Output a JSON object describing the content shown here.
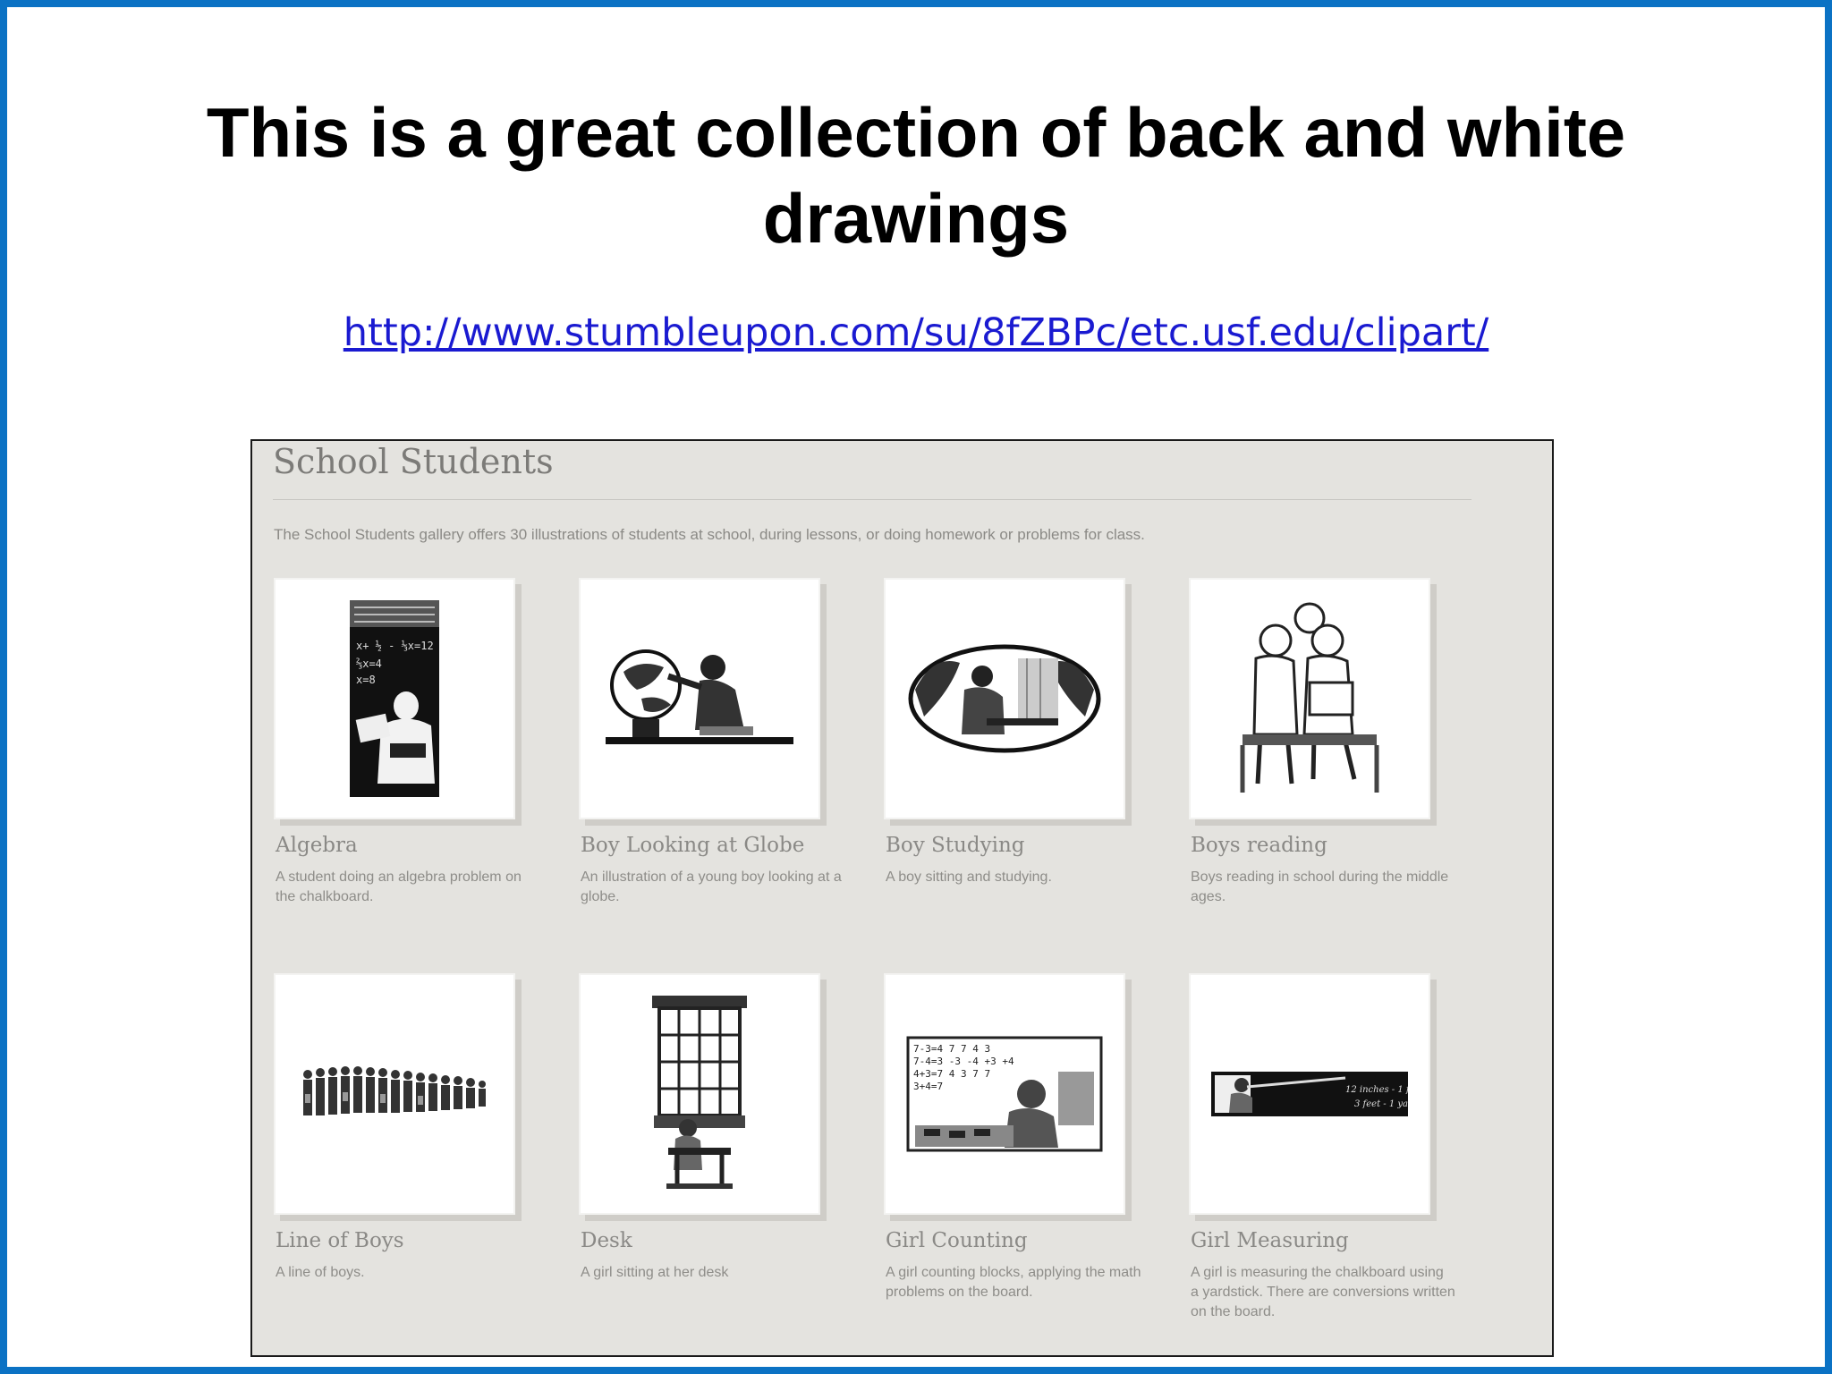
{
  "slide": {
    "title": "This is a great collection of back and white drawings",
    "link": "http://www.stumbleupon.com/su/8fZBPc/etc.usf.edu/clipart/"
  },
  "gallery": {
    "heading": "School Students",
    "intro": "The School Students gallery offers 30 illustrations of students at school, during lessons, or doing homework or problems for class.",
    "items": [
      {
        "title": "Algebra",
        "description": "A student doing an algebra problem on the chalkboard."
      },
      {
        "title": "Boy Looking at Globe",
        "description": "An illustration of a young boy looking at a globe."
      },
      {
        "title": "Boy Studying",
        "description": "A boy sitting and studying."
      },
      {
        "title": "Boys reading",
        "description": "Boys reading in school during the middle ages."
      },
      {
        "title": "Line of Boys",
        "description": "A line of boys."
      },
      {
        "title": "Desk",
        "description": "A girl sitting at her desk"
      },
      {
        "title": "Girl Counting",
        "description": "A girl counting blocks, applying the math problems on the board."
      },
      {
        "title": "Girl Measuring",
        "description": "A girl is measuring the chalkboard using a yardstick. There are conversions written on the board."
      }
    ]
  },
  "colors": {
    "frame": "#0b72c4",
    "link": "#1a1ad1",
    "gallery_background": "#e4e3df"
  }
}
